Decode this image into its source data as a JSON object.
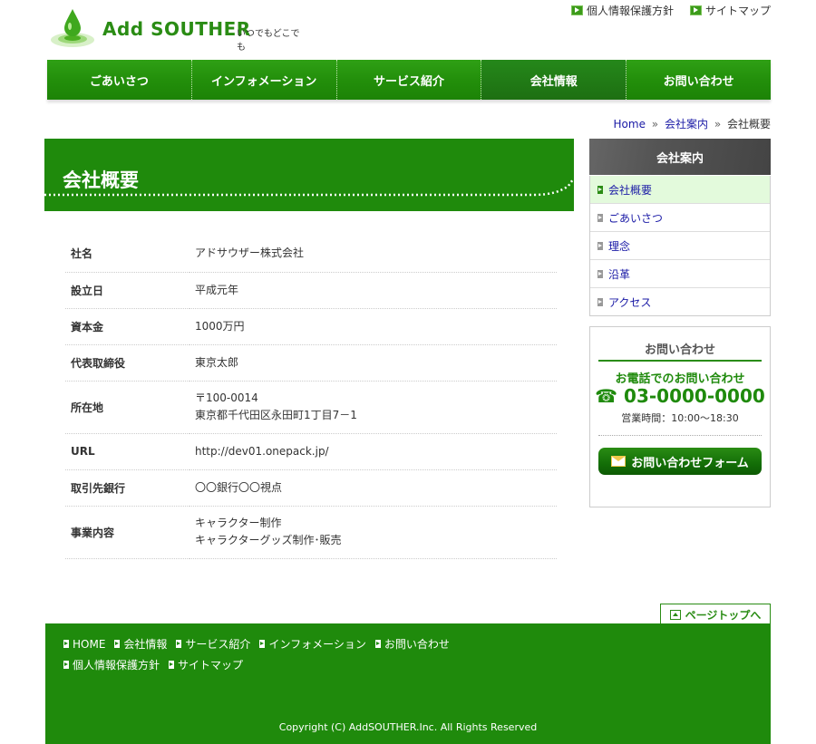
{
  "header": {
    "logo_text": "Add SOUTHER",
    "tagline": "いつでもどこでも",
    "util_links": [
      {
        "label": "個人情報保護方針"
      },
      {
        "label": "サイトマップ"
      }
    ]
  },
  "nav": [
    {
      "label": "ごあいさつ"
    },
    {
      "label": "インフォメーション"
    },
    {
      "label": "サービス紹介"
    },
    {
      "label": "会社情報"
    },
    {
      "label": "お問い合わせ"
    }
  ],
  "breadcrumb": {
    "home": "Home",
    "parent": "会社案内",
    "current": "会社概要",
    "sep": "»"
  },
  "main": {
    "title": "会社概要",
    "rows": [
      {
        "key": "社名",
        "value": "アドサウザー株式会社"
      },
      {
        "key": "設立日",
        "value": "平成元年"
      },
      {
        "key": "資本金",
        "value": "1000万円"
      },
      {
        "key": "代表取締役",
        "value": "東京太郎"
      },
      {
        "key": "所在地",
        "value": "〒100-0014",
        "value2": "東京都千代田区永田町1丁目7－1"
      },
      {
        "key": "URL",
        "value": "http://dev01.onepack.jp/"
      },
      {
        "key": "取引先銀行",
        "value": "〇〇銀行〇〇視点"
      },
      {
        "key": "事業内容",
        "value": "キャラクター制作",
        "value2": "キャラクターグッズ制作･販売"
      }
    ]
  },
  "sidebar": {
    "heading": "会社案内",
    "items": [
      {
        "label": "会社概要"
      },
      {
        "label": "ごあいさつ"
      },
      {
        "label": "理念"
      },
      {
        "label": "沿革"
      },
      {
        "label": "アクセス"
      }
    ],
    "contact": {
      "heading": "お問い合わせ",
      "phone_lead": "お電話でのお問い合わせ",
      "phone": "☎ 03-0000-0000",
      "hours": "営業時間：10:00～18:30",
      "form_button": "お問い合わせフォーム"
    }
  },
  "page_top": "ページトップへ",
  "footer": {
    "row1": [
      {
        "label": "HOME"
      },
      {
        "label": "会社情報"
      },
      {
        "label": "サービス紹介"
      },
      {
        "label": "インフォメーション"
      },
      {
        "label": "お問い合わせ"
      }
    ],
    "row2": [
      {
        "label": "個人情報保護方針"
      },
      {
        "label": "サイトマップ"
      }
    ],
    "copyright": "Copyright (C) AddSOUTHER.Inc. All Rights Reserved"
  },
  "colors": {
    "brand_green": "#1f8a0c",
    "nav_green": "#2fa015",
    "link_blue": "#1a1aa6",
    "sidebar_head": "#555555",
    "current_bg": "#e3fadc"
  }
}
